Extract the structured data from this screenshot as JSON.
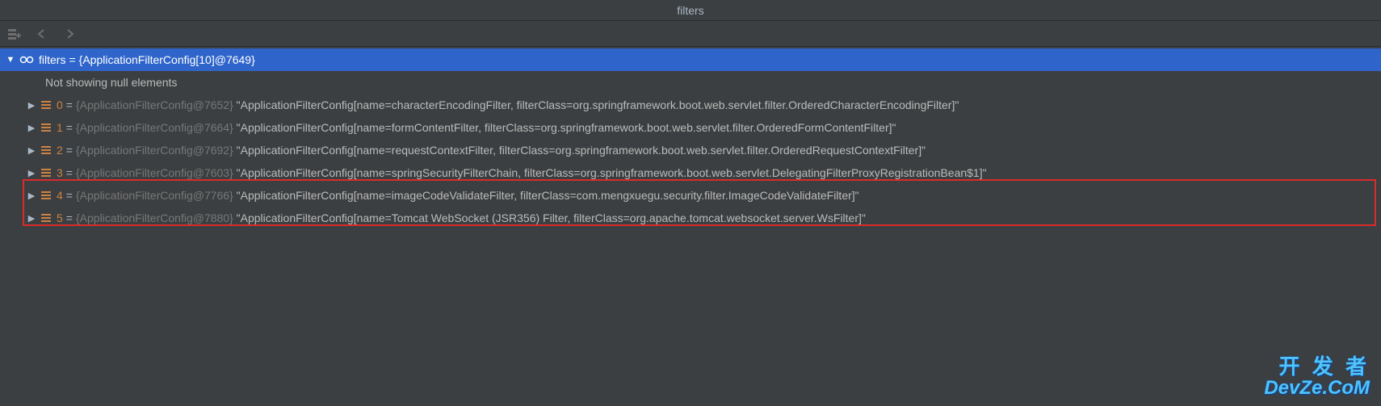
{
  "window": {
    "title": "filters"
  },
  "tree": {
    "root": {
      "name": "filters",
      "type": "{ApplicationFilterConfig[10]@7649}"
    },
    "null_message": "Not showing null elements",
    "items": [
      {
        "index": "0",
        "type": "{ApplicationFilterConfig@7652}",
        "value": "\"ApplicationFilterConfig[name=characterEncodingFilter, filterClass=org.springframework.boot.web.servlet.filter.OrderedCharacterEncodingFilter]\""
      },
      {
        "index": "1",
        "type": "{ApplicationFilterConfig@7664}",
        "value": "\"ApplicationFilterConfig[name=formContentFilter, filterClass=org.springframework.boot.web.servlet.filter.OrderedFormContentFilter]\""
      },
      {
        "index": "2",
        "type": "{ApplicationFilterConfig@7692}",
        "value": "\"ApplicationFilterConfig[name=requestContextFilter, filterClass=org.springframework.boot.web.servlet.filter.OrderedRequestContextFilter]\""
      },
      {
        "index": "3",
        "type": "{ApplicationFilterConfig@7603}",
        "value": "\"ApplicationFilterConfig[name=springSecurityFilterChain, filterClass=org.springframework.boot.web.servlet.DelegatingFilterProxyRegistrationBean$1]\""
      },
      {
        "index": "4",
        "type": "{ApplicationFilterConfig@7766}",
        "value": "\"ApplicationFilterConfig[name=imageCodeValidateFilter, filterClass=com.mengxuegu.security.filter.ImageCodeValidateFilter]\""
      },
      {
        "index": "5",
        "type": "{ApplicationFilterConfig@7880}",
        "value": "\"ApplicationFilterConfig[name=Tomcat WebSocket (JSR356) Filter, filterClass=org.apache.tomcat.websocket.server.WsFilter]\""
      }
    ]
  },
  "watermark": {
    "cn": "开 发 者",
    "en": "DevZe.CoM"
  }
}
